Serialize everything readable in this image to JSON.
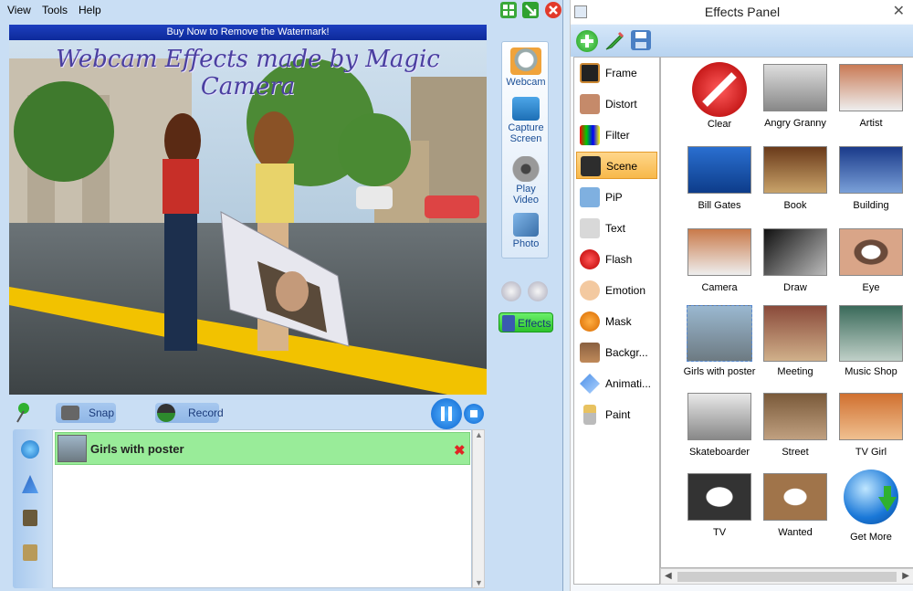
{
  "menu": {
    "view": "View",
    "tools": "Tools",
    "help": "Help"
  },
  "watermark_text": "Buy Now to Remove the Watermark!",
  "video_overlay_title": "Webcam Effects made by Magic Camera",
  "source_buttons": [
    {
      "label_line1": "Webcam",
      "label_line2": ""
    },
    {
      "label_line1": "Capture",
      "label_line2": "Screen"
    },
    {
      "label_line1": "Play",
      "label_line2": "Video"
    },
    {
      "label_line1": "Photo",
      "label_line2": ""
    }
  ],
  "effects_toggle_label": "Effects",
  "toolbar": {
    "snap": "Snap",
    "record": "Record"
  },
  "current_effect_item": "Girls with poster",
  "panel": {
    "title": "Effects Panel",
    "categories": [
      "Frame",
      "Distort",
      "Filter",
      "Scene",
      "PiP",
      "Text",
      "Flash",
      "Emotion",
      "Mask",
      "Backgr...",
      "Animati...",
      "Paint"
    ],
    "selected_category": "Scene",
    "effects": [
      "Clear",
      "Angry Granny",
      "Artist",
      "Bill Gates",
      "Book",
      "Building",
      "Camera",
      "Draw",
      "Eye",
      "Girls with poster",
      "Meeting",
      "Music Shop",
      "Skateboarder",
      "Street",
      "TV Girl",
      "TV",
      "Wanted",
      "Get More"
    ]
  },
  "colors": {
    "accent_blue": "#1a4e96",
    "selected_category": "#f7b84a",
    "list_item": "#99ec99"
  }
}
